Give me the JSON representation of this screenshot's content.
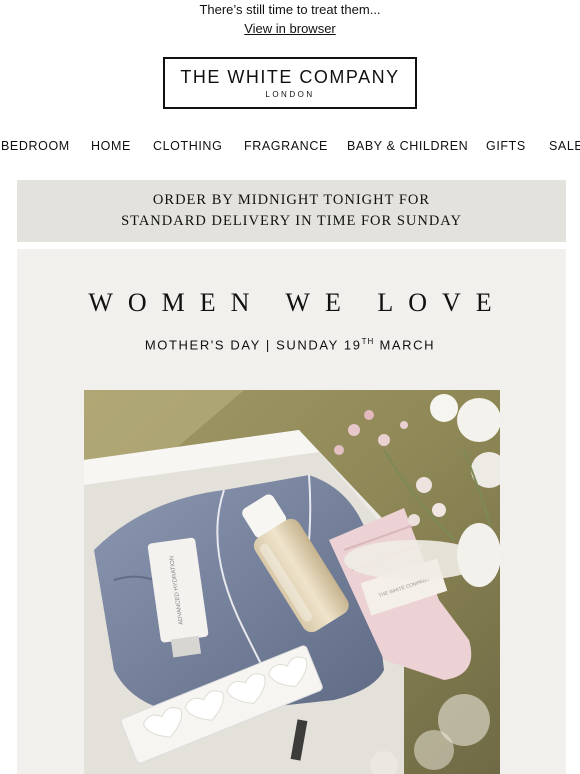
{
  "preheader": {
    "text": "There’s still time to treat them...",
    "view_link": "View in browser"
  },
  "logo": {
    "brand": "THE WHITE COMPANY",
    "sub": "LONDON"
  },
  "nav": [
    {
      "label": "BEDROOM"
    },
    {
      "label": "HOME"
    },
    {
      "label": "CLOTHING"
    },
    {
      "label": "FRAGRANCE"
    },
    {
      "label": "BABY & CHILDREN"
    },
    {
      "label": "GIFTS"
    },
    {
      "label": "SALE"
    }
  ],
  "banner": {
    "line1": "ORDER BY MIDNIGHT TONIGHT FOR",
    "line2": "STANDARD DELIVERY IN TIME FOR SUNDAY"
  },
  "hero": {
    "title": "WOMEN WE LOVE",
    "subtitle_pre": "MOTHER'S DAY | SUNDAY 19",
    "subtitle_sup": "TH",
    "subtitle_post": " MARCH",
    "product_labels": {
      "tube": "ADVANCED HYDRATION",
      "socks_tag": "THE WHITE COMPANY"
    }
  },
  "colors": {
    "banner_bg": "#e3e2dc",
    "hero_bg": "#f1f0ed",
    "text": "#111111"
  }
}
